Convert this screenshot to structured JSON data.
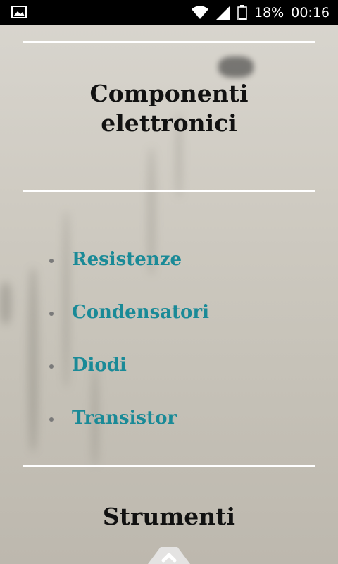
{
  "status": {
    "battery": "18%",
    "time": "00:16",
    "icons": [
      "image-icon",
      "wifi-icon",
      "signal-icon",
      "battery-icon"
    ]
  },
  "header": {
    "title_line1": "Componenti",
    "title_line2": "elettronici"
  },
  "menu": {
    "items": [
      "Resistenze",
      "Condensatori",
      "Diodi",
      "Transistor"
    ]
  },
  "section2": {
    "title": "Strumenti"
  },
  "colors": {
    "link": "#1a8a97",
    "title": "#111111",
    "rule": "#ffffff"
  }
}
